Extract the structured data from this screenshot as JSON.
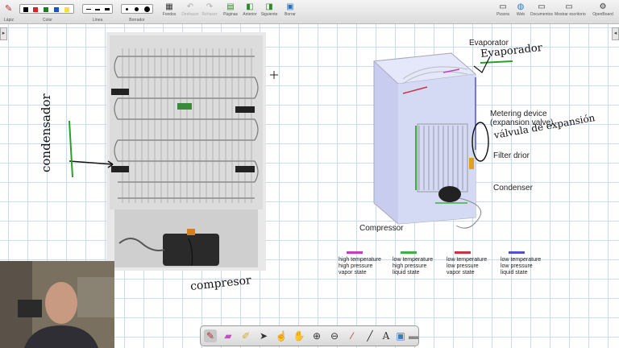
{
  "toolbar": {
    "groups": {
      "pens": "Lápiz",
      "color": "Color",
      "line": "Línea",
      "eraser": "Borrador"
    },
    "buttons": {
      "backgrounds": "Fondos",
      "undo": "Deshacer",
      "redo": "Rehacer",
      "pages": "Páginas",
      "previous": "Anterior",
      "next": "Siguiente",
      "delete": "Borrar",
      "board": "Pizarra",
      "web": "Web",
      "documents": "Documentos",
      "show_desktop": "Mostrar escritorio",
      "openboard": "OpenBoard"
    },
    "colors": [
      "#000000",
      "#e02020",
      "#1e7a1e",
      "#1a4fd0",
      "#f0e040"
    ]
  },
  "diagram": {
    "labels": {
      "evaporator": "Evaporator",
      "metering": "Metering device",
      "expansion": "(expansion valve)",
      "filter": "Filter drior",
      "condenser": "Condenser",
      "compressor": "Compressor"
    },
    "legend": [
      {
        "lines": [
          "high temperature",
          "high pressure",
          "vapor state"
        ],
        "color": "#c040c0"
      },
      {
        "lines": [
          "low temperature",
          "high pressure",
          "liquid state"
        ],
        "color": "#40b040"
      },
      {
        "lines": [
          "low temperature",
          "low pressure",
          "vapor state"
        ],
        "color": "#d03040"
      },
      {
        "lines": [
          "low temperature",
          "low pressure",
          "liquid state"
        ],
        "color": "#5050d0"
      }
    ]
  },
  "handwriting": {
    "condensador": "condensador",
    "evaporador": "Evaporador",
    "valvula": "válvula de expansión",
    "compresor": "compresor"
  }
}
